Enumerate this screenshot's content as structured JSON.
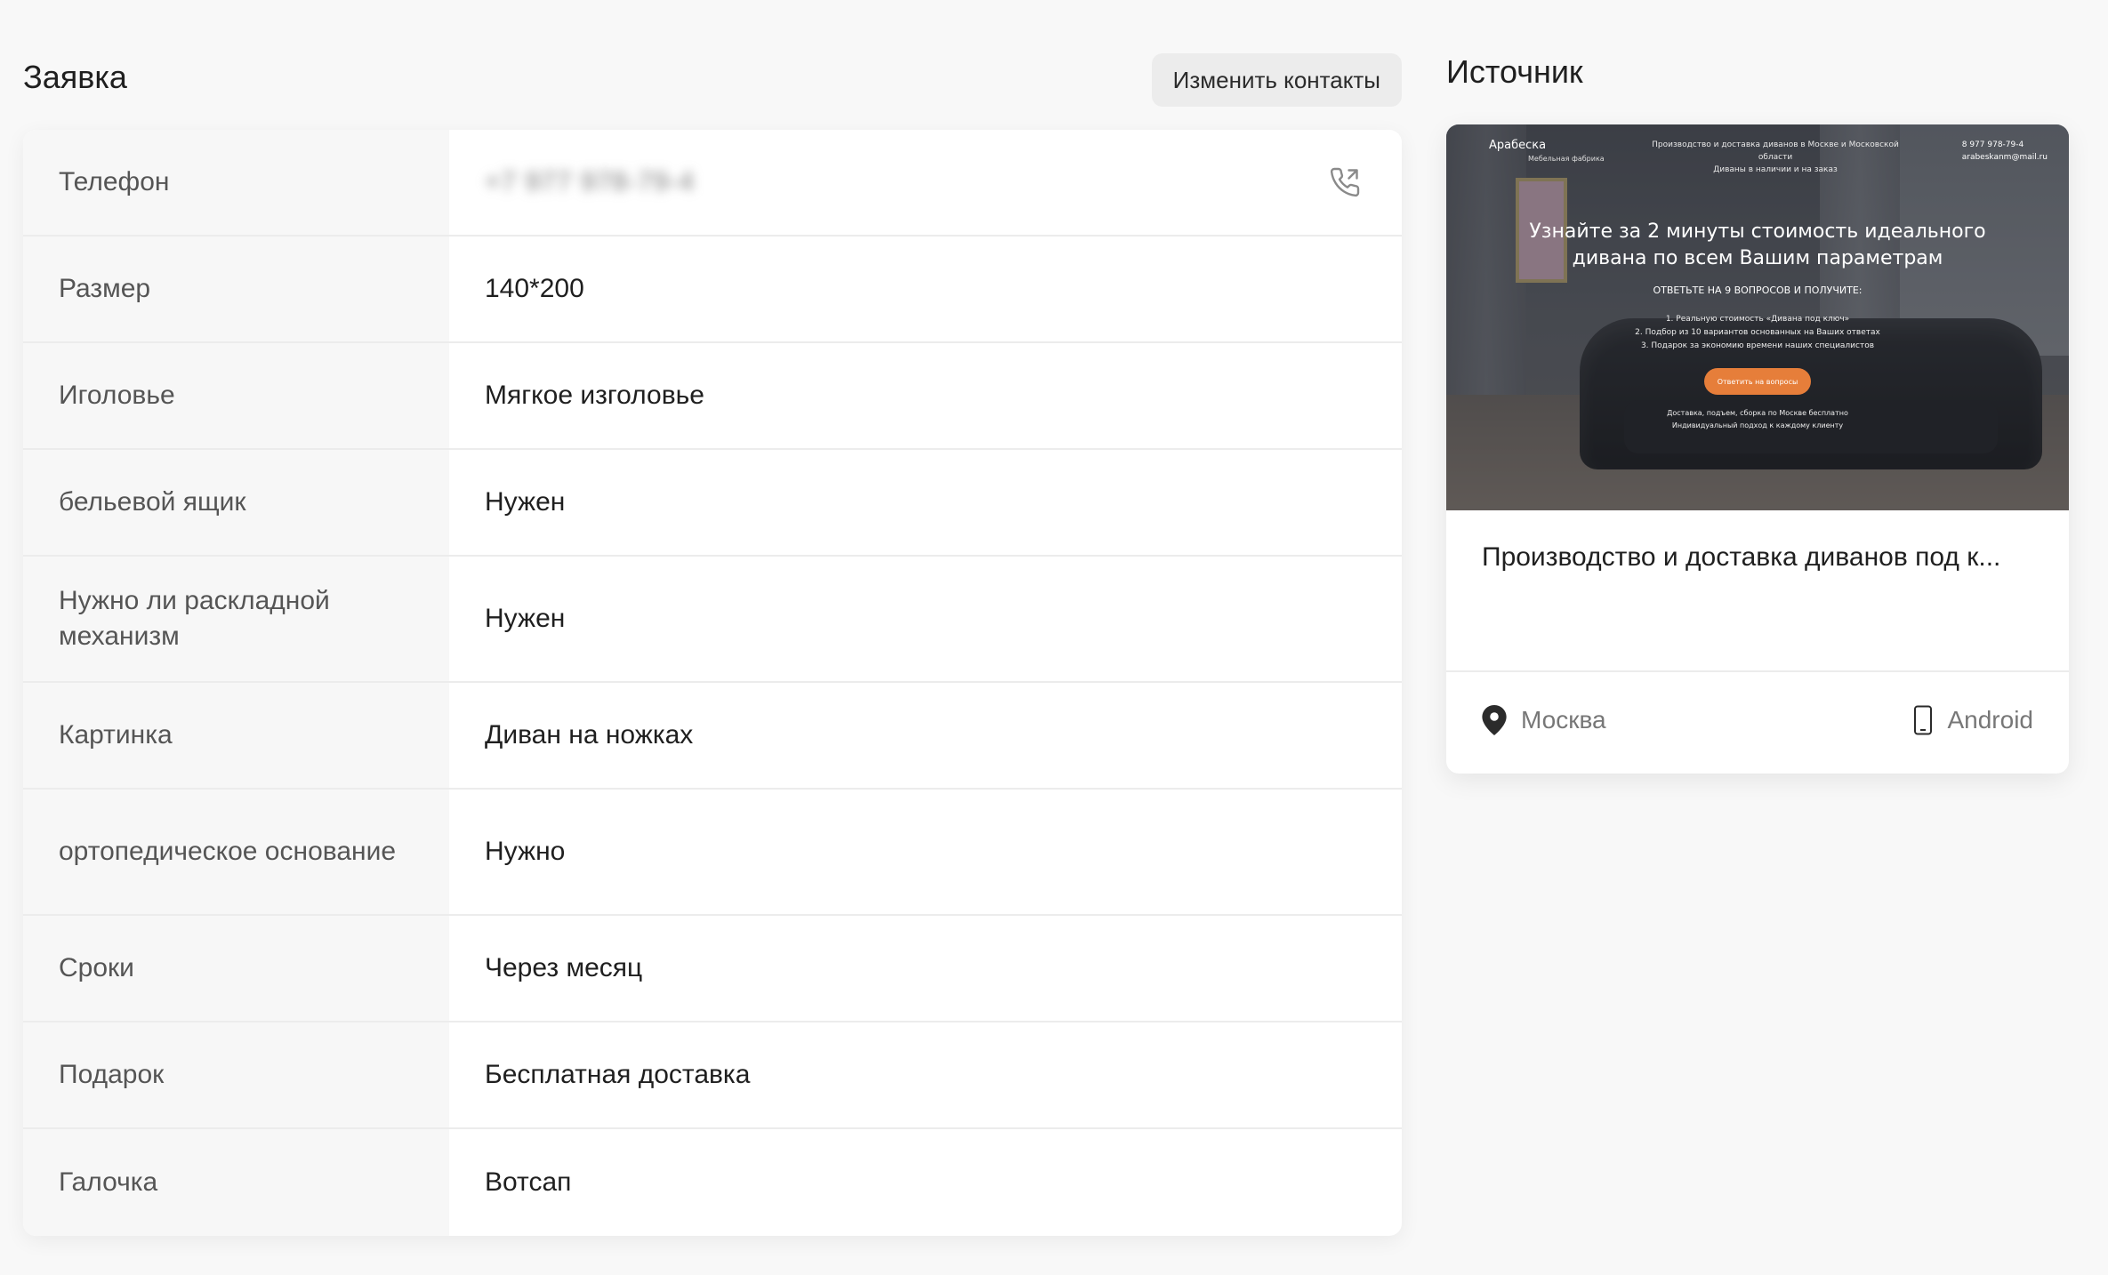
{
  "application": {
    "title": "Заявка",
    "change_contacts_label": "Изменить контакты",
    "rows": [
      {
        "label": "Телефон",
        "value": "+7 977 978-79-4",
        "blurred": true
      },
      {
        "label": "Размер",
        "value": "140*200"
      },
      {
        "label": "Иголовье",
        "value": "Мягкое изголовье"
      },
      {
        "label": "бельевой ящик",
        "value": "Нужен"
      },
      {
        "label": "Нужно ли раскладной механизм",
        "value": "Нужен"
      },
      {
        "label": "Картинка",
        "value": "Диван на ножках"
      },
      {
        "label": "ортопедическое основание",
        "value": "Нужно"
      },
      {
        "label": "Сроки",
        "value": "Через месяц"
      },
      {
        "label": "Подарок",
        "value": "Бесплатная доставка"
      },
      {
        "label": "Галочка",
        "value": "Вотсап"
      }
    ],
    "phone_icon": "phone-icon"
  },
  "source": {
    "title": "Источник",
    "card_title": "Производство и доставка диванов под к...",
    "location": "Москва",
    "device": "Android",
    "location_icon": "map-pin-icon",
    "device_icon": "smartphone-icon",
    "preview": {
      "logo": "Арабеска",
      "logo_sub": "Мебельная фабрика",
      "top_line_1": "Производство и доставка диванов в Москве и Московской области",
      "top_line_2": "Диваны в наличии и на заказ",
      "phone": "8 977 978-79-4",
      "email": "arabeskanm@mail.ru",
      "headline": "Узнайте за 2 минуты стоимость идеального дивана по всем Вашим параметрам",
      "subheadline": "ОТВЕТЬТЕ НА 9 ВОПРОСОВ И ПОЛУЧИТЕ:",
      "list_1": "1. Реальную стоимость «Дивана под ключ»",
      "list_2": "2. Подбор из 10 вариантов основанных на Ваших ответах",
      "list_3": "3. Подарок за экономию времени наших специалистов",
      "cta": "Ответить на вопросы",
      "bottom_1": "Доставка, подъем, сборка по Москве бесплатно",
      "bottom_2": "Индивидуальный подход к каждому клиенту"
    }
  }
}
